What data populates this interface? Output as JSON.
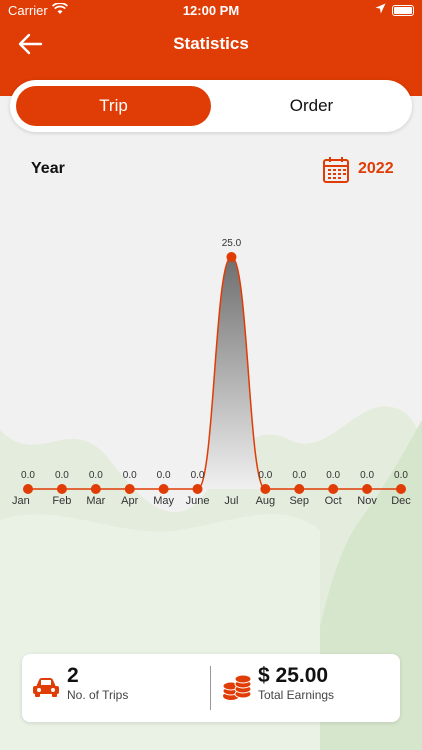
{
  "status_bar": {
    "carrier": "Carrier",
    "time": "12:00 PM"
  },
  "header": {
    "title": "Statistics"
  },
  "tabs": [
    {
      "label": "Trip",
      "active": true
    },
    {
      "label": "Order",
      "active": false
    }
  ],
  "period": {
    "label": "Year",
    "value": "2022"
  },
  "colors": {
    "brand": "#e03c05",
    "hills": "#dde9d4"
  },
  "icons": [
    "back-arrow-icon",
    "wifi-icon",
    "location-arrow-icon",
    "battery-icon",
    "calendar-icon",
    "car-icon",
    "coins-icon"
  ],
  "chart_data": {
    "type": "area",
    "categories": [
      "Jan",
      "Feb",
      "Mar",
      "Apr",
      "May",
      "June",
      "Jul",
      "Aug",
      "Sep",
      "Oct",
      "Nov",
      "Dec"
    ],
    "values": [
      0,
      0,
      0,
      0,
      0,
      0,
      25,
      0,
      0,
      0,
      0,
      0
    ],
    "value_labels": [
      "0.0",
      "0.0",
      "0.0",
      "0.0",
      "0.0",
      "0.0",
      "25.0",
      "0.0",
      "0.0",
      "0.0",
      "0.0",
      "0.0"
    ],
    "title": "",
    "xlabel": "",
    "ylabel": "",
    "ylim": [
      0,
      25
    ],
    "grid": false,
    "legend": "none",
    "line_color": "#e03c05",
    "fill_gradient": [
      "#6e6e6e",
      "#f0f0f0"
    ]
  },
  "summary": {
    "trips_value": "2",
    "trips_label": "No. of Trips",
    "earnings_value": "$ 25.00",
    "earnings_label": "Total Earnings"
  }
}
